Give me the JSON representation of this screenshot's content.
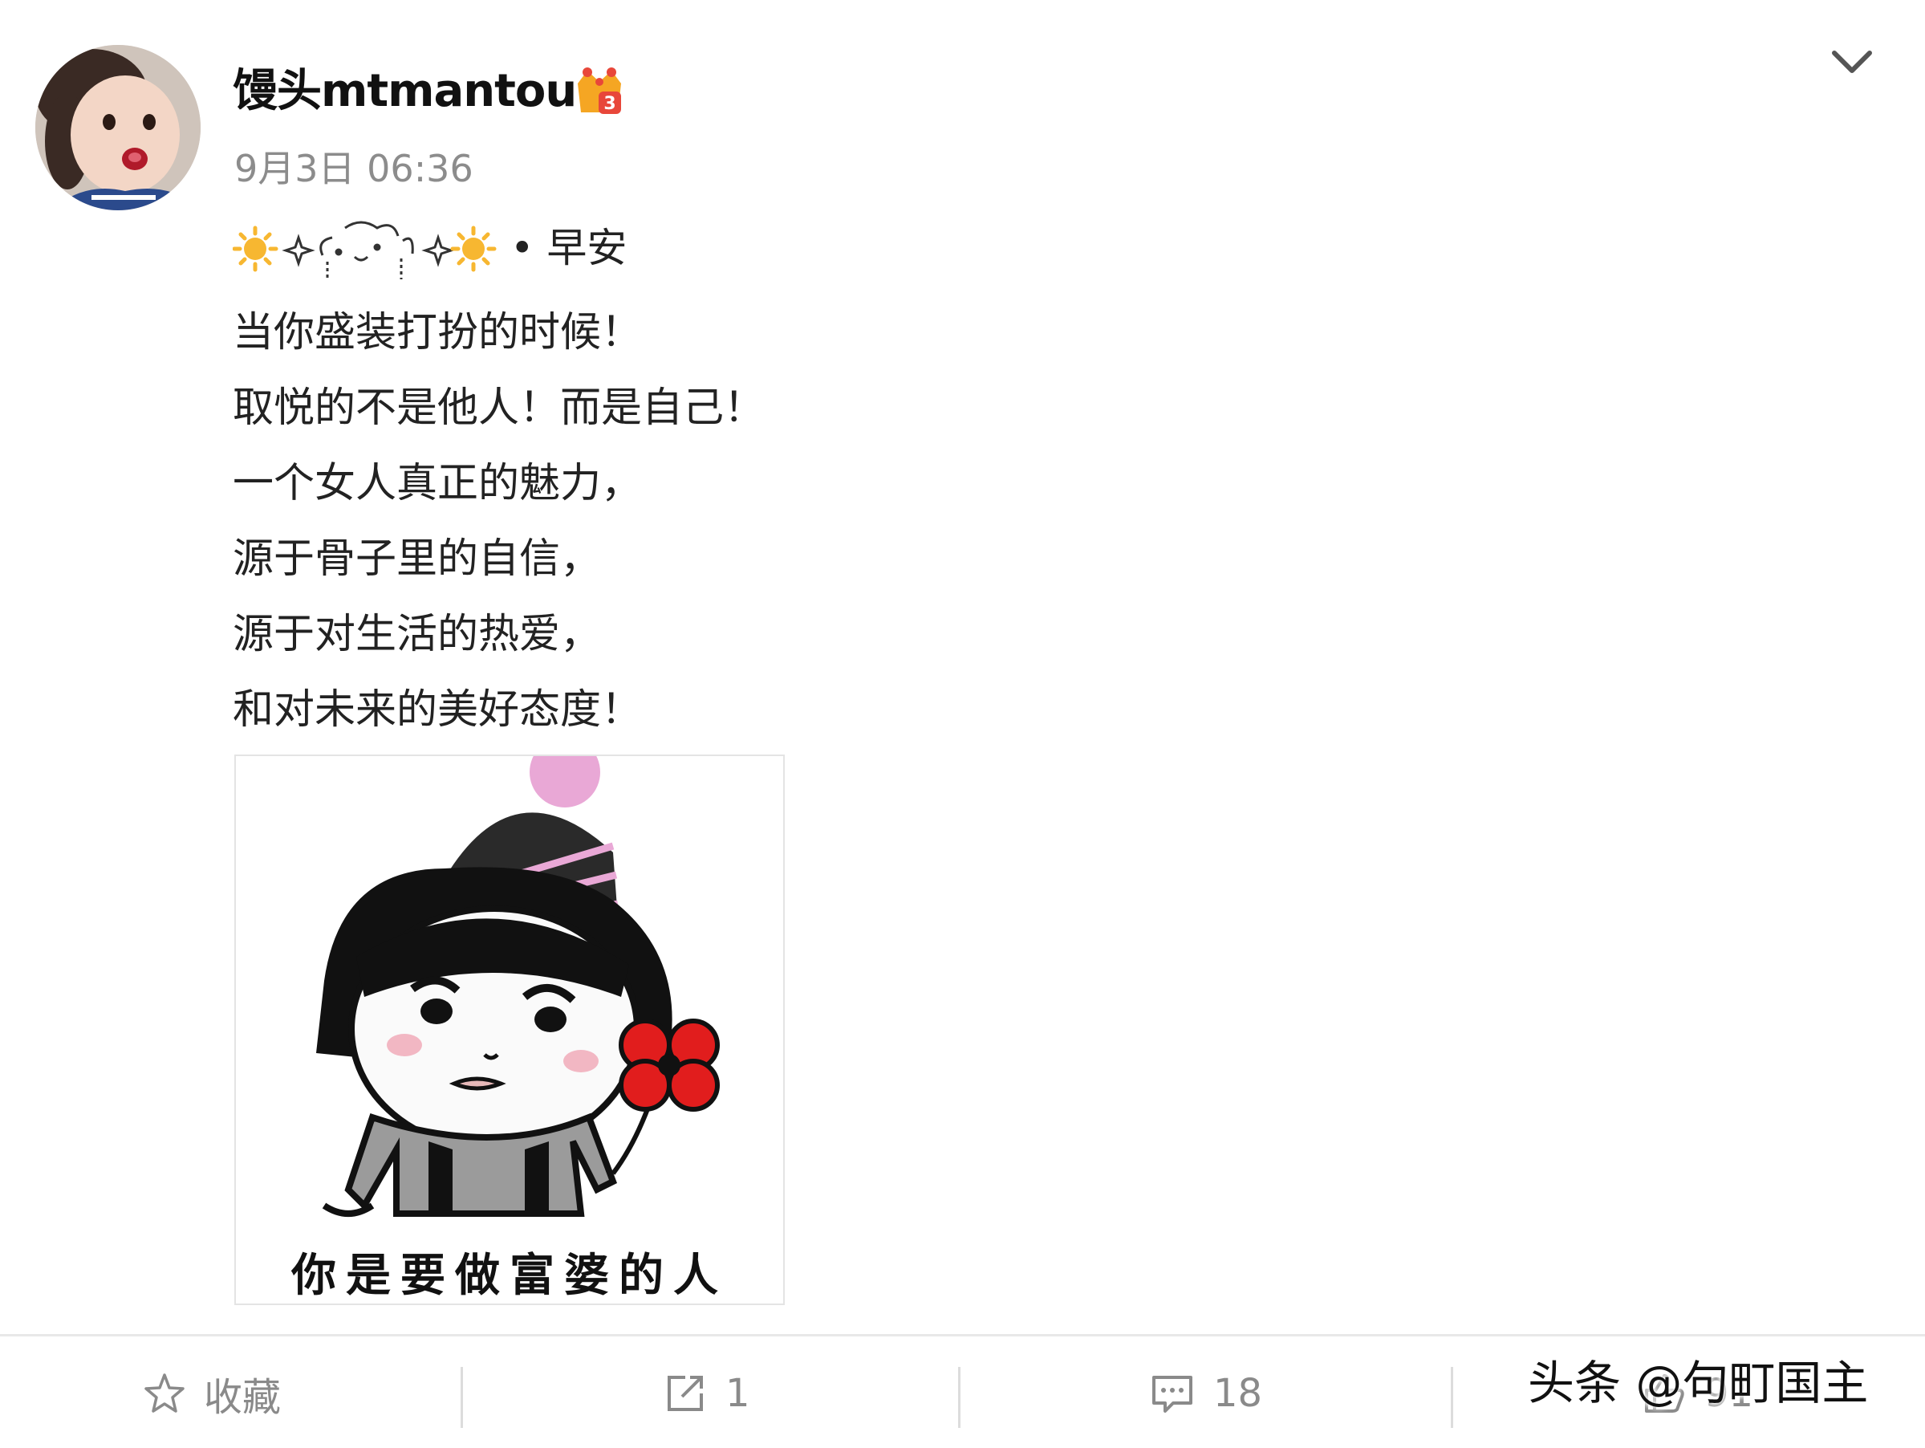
{
  "post": {
    "username": "馒头mtmantou",
    "timestamp": "9月3日 06:36",
    "greeting": "• 早安",
    "lines": [
      "当你盛装打扮的时候！",
      "取悦的不是他人！而是自己！",
      "一个女人真正的魅力，",
      "源于骨子里的自信，",
      "源于对生活的热爱，",
      "和对未来的美好态度！"
    ],
    "image_caption": "你是要做富婆的人"
  },
  "actions": {
    "favorite_label": "收藏",
    "repost_count": "1",
    "comment_count": "18",
    "like_count": "91"
  },
  "watermark": "头条 @句町国主",
  "colors": {
    "accent_badge": "#f5a623",
    "text_muted": "#8c8c8c",
    "sun": "#f7b731",
    "hat_pink": "#e9a8d6",
    "flower_red": "#e11d1d"
  },
  "icons": [
    "vip-crown-icon",
    "chevron-down-icon",
    "sun-icon",
    "sparkle-icon",
    "star-icon",
    "repost-icon",
    "comment-icon",
    "like-icon"
  ]
}
